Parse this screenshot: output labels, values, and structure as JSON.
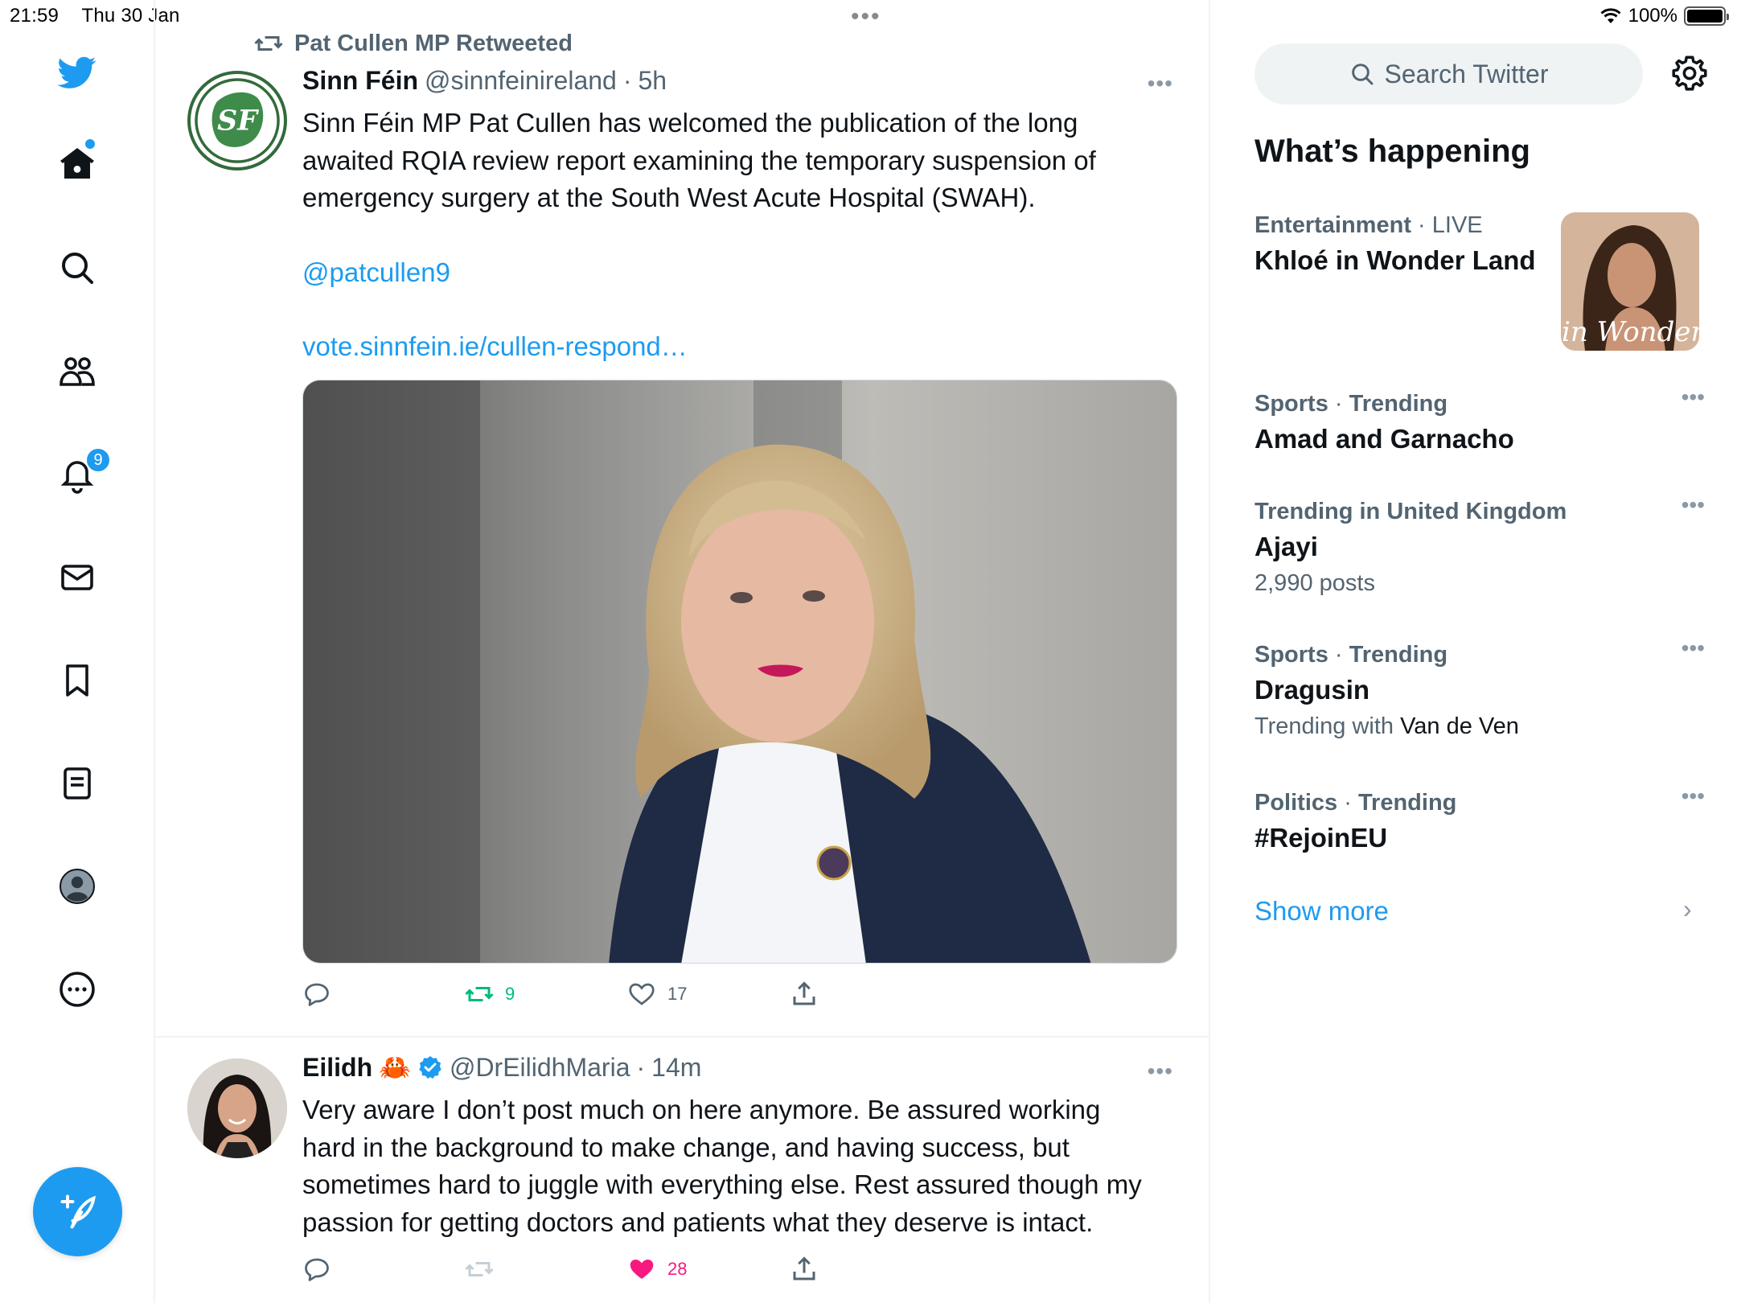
{
  "status_bar": {
    "time": "21:59",
    "date": "Thu 30 Jan",
    "battery": "100%"
  },
  "nav": {
    "notifications_badge": "9"
  },
  "tweets": [
    {
      "retweet_context": "Pat Cullen MP Retweeted",
      "name": "Sinn Féin",
      "handle": "@sinnfeinireland",
      "time": "5h",
      "text_lines": [
        "Sinn Féin MP Pat Cullen has welcomed the publication of the long",
        "awaited RQIA review report examining the temporary suspension of",
        "emergency surgery at the South West Acute Hospital (SWAH)."
      ],
      "mention": "@patcullen9",
      "url": "vote.sinnfein.ie/cullen-respond…",
      "retweets": "9",
      "likes": "17"
    },
    {
      "name": "Eilidh",
      "emoji": "🦀",
      "handle": "@DrEilidhMaria",
      "time": "14m",
      "text_lines": [
        "Very aware I don’t post much on here anymore. Be assured working",
        "hard in the background to make change, and having success, but",
        "sometimes hard to juggle with everything else. Rest assured though my",
        "passion for getting doctors and patients what they deserve is intact."
      ],
      "likes": "28"
    }
  ],
  "sidebar_right": {
    "search_placeholder": "Search Twitter",
    "title": "What’s happening",
    "trends": [
      {
        "category": "Entertainment",
        "label": "LIVE",
        "title": "Khloé in Wonder Land",
        "image_caption": "é in Wonder I"
      },
      {
        "category": "Sports",
        "label": "Trending",
        "title": "Amad and Garnacho"
      },
      {
        "category": "Trending in United Kingdom",
        "label": "",
        "title": "Ajayi",
        "sub": "2,990 posts"
      },
      {
        "category": "Sports",
        "label": "Trending",
        "title": "Dragusin",
        "sub_prefix": "Trending with",
        "sub_value": "Van de Ven"
      },
      {
        "category": "Politics",
        "label": "Trending",
        "title": "#RejoinEU"
      }
    ],
    "show_more": "Show more"
  },
  "colors": {
    "accent": "#1d9bf0",
    "retweet_green": "#00ba7c",
    "like_pink": "#f91880",
    "sinn_fein_green": "#326b3a"
  }
}
